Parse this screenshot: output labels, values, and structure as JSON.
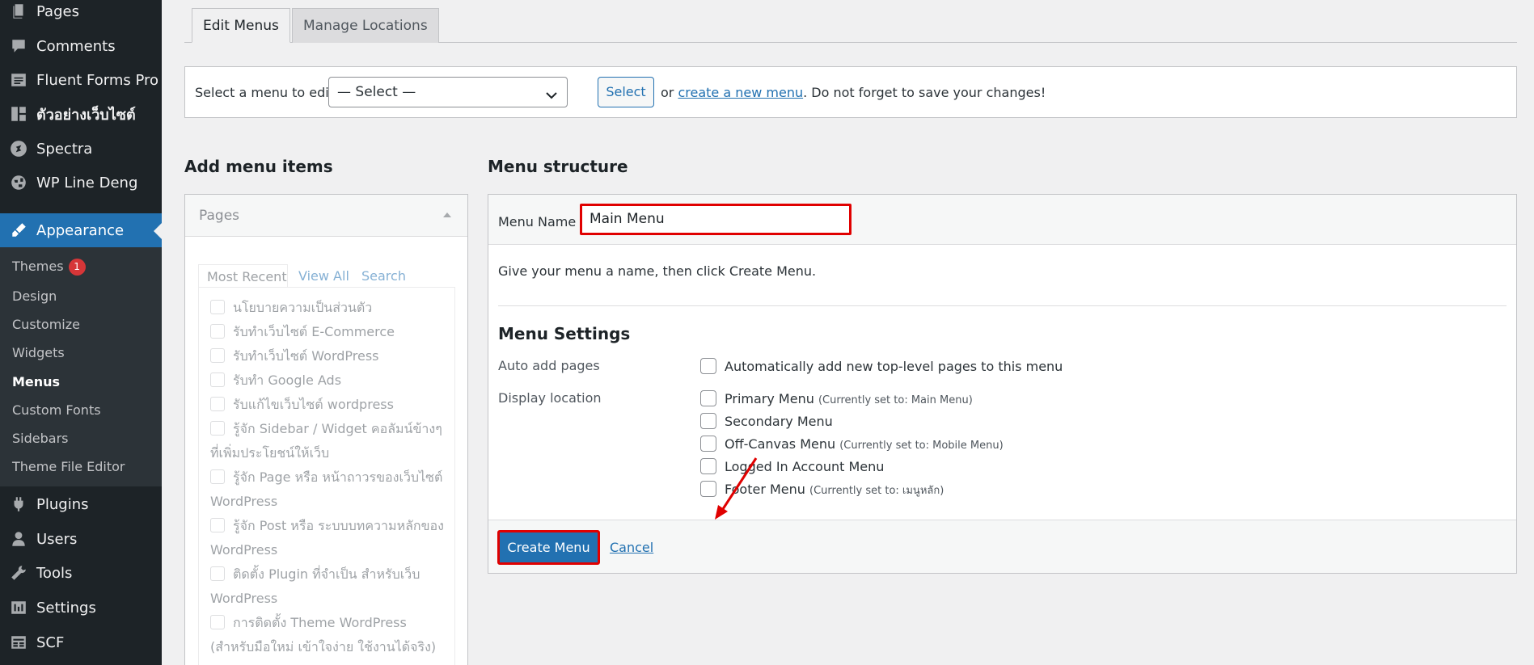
{
  "sidebar": {
    "items": [
      {
        "label": "Pages",
        "icon": "pages-icon"
      },
      {
        "label": "Comments",
        "icon": "comments-icon"
      },
      {
        "label": "Fluent Forms Pro",
        "icon": "forms-icon"
      },
      {
        "label": "ตัวอย่างเว็บไซต์",
        "icon": "layout-icon"
      },
      {
        "label": "Spectra",
        "icon": "spectra-icon"
      },
      {
        "label": "WP Line Deng",
        "icon": "globe-icon"
      },
      {
        "label": "Appearance",
        "icon": "brush-icon"
      },
      {
        "label": "Plugins",
        "icon": "plugin-icon"
      },
      {
        "label": "Users",
        "icon": "user-icon"
      },
      {
        "label": "Tools",
        "icon": "wrench-icon"
      },
      {
        "label": "Settings",
        "icon": "settings-icon"
      },
      {
        "label": "SCF",
        "icon": "table-icon"
      }
    ],
    "submenu": [
      {
        "label": "Themes",
        "badge": "1"
      },
      {
        "label": "Design"
      },
      {
        "label": "Customize"
      },
      {
        "label": "Widgets"
      },
      {
        "label": "Menus"
      },
      {
        "label": "Custom Fonts"
      },
      {
        "label": "Sidebars"
      },
      {
        "label": "Theme File Editor"
      }
    ]
  },
  "tabs": [
    "Edit Menus",
    "Manage Locations"
  ],
  "select_menu": {
    "label": "Select a menu to edit:",
    "dropdown_value": "— Select —",
    "button": "Select",
    "tail_prefix": "or",
    "link": "create a new menu",
    "tail_suffix": ". Do not forget to save your changes!"
  },
  "add_items": {
    "heading": "Add menu items",
    "panel_title": "Pages",
    "tabs": [
      "Most Recent",
      "View All",
      "Search"
    ],
    "pages": [
      "นโยบายความเป็นส่วนตัว",
      "รับทำเว็บไซต์ E-Commerce",
      "รับทำเว็บไซต์ WordPress",
      "รับทำ Google Ads",
      "รับแก้ไขเว็บไซต์ wordpress",
      "รู้จัก Sidebar / Widget คอลัมน์ข้างๆ ที่เพิ่มประโยชน์ให้เว็บ",
      "รู้จัก Page หรือ หน้าถาวรของเว็บไซต์ WordPress",
      "รู้จัก Post หรือ ระบบบทความหลักของ WordPress",
      "ติดตั้ง Plugin ที่จำเป็น สำหรับเว็บ WordPress",
      "การติดตั้ง Theme WordPress (สำหรับมือใหม่ เข้าใจง่าย ใช้งานได้จริง)"
    ]
  },
  "menu_structure": {
    "heading": "Menu structure",
    "name_label": "Menu Name",
    "name_value": "Main Menu",
    "hint": "Give your menu a name, then click Create Menu.",
    "settings_title": "Menu Settings",
    "auto_add_label": "Auto add pages",
    "auto_add_option": "Automatically add new top-level pages to this menu",
    "display_label": "Display location",
    "locations": [
      {
        "label": "Primary Menu",
        "note": "(Currently set to: Main Menu)"
      },
      {
        "label": "Secondary Menu",
        "note": ""
      },
      {
        "label": "Off-Canvas Menu",
        "note": "(Currently set to: Mobile Menu)"
      },
      {
        "label": "Logged In Account Menu",
        "note": ""
      },
      {
        "label": "Footer Menu",
        "note": "(Currently set to: เมนูหลัก)"
      }
    ],
    "create_button": "Create Menu",
    "cancel": "Cancel"
  },
  "colors": {
    "accent": "#2271b1",
    "sidebar_bg": "#1d2327",
    "highlight_red": "#e00000",
    "badge": "#d63638"
  }
}
